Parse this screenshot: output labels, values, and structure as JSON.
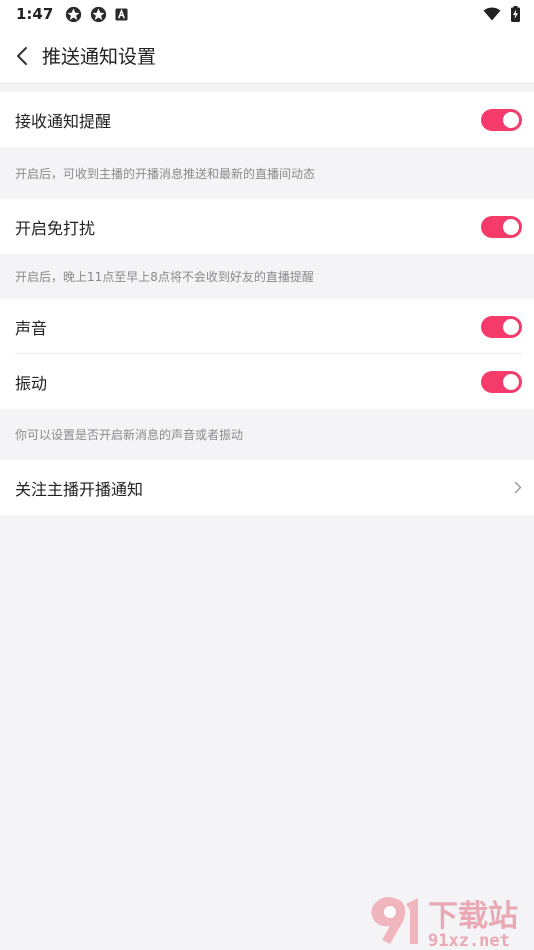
{
  "status_bar": {
    "time": "1:47",
    "left_icons": [
      "app-icon",
      "app-icon",
      "a-box-icon"
    ],
    "right_icons": [
      "wifi-icon",
      "battery-charging-icon"
    ]
  },
  "nav": {
    "title": "推送通知设置",
    "back_icon": "chevron-left-icon"
  },
  "settings": {
    "receive": {
      "label": "接收通知提醒",
      "enabled": true,
      "hint": "开启后，可收到主播的开播消息推送和最新的直播间动态"
    },
    "dnd": {
      "label": "开启免打扰",
      "enabled": true,
      "hint": "开启后，晚上11点至早上8点将不会收到好友的直播提醒"
    },
    "sound": {
      "label": "声音",
      "enabled": true
    },
    "vibrate": {
      "label": "振动",
      "enabled": true
    },
    "sound_vibrate_hint": "你可以设置是否开启新消息的声音或者振动",
    "follow": {
      "label": "关注主播开播通知",
      "icon": "chevron-right-icon"
    }
  },
  "colors": {
    "accent": "#f53b6a",
    "background": "#f4f4f6",
    "hint_text": "#8a8a8e"
  },
  "watermark": {
    "text_top": "下载站",
    "text_bottom": "91xz.net"
  }
}
